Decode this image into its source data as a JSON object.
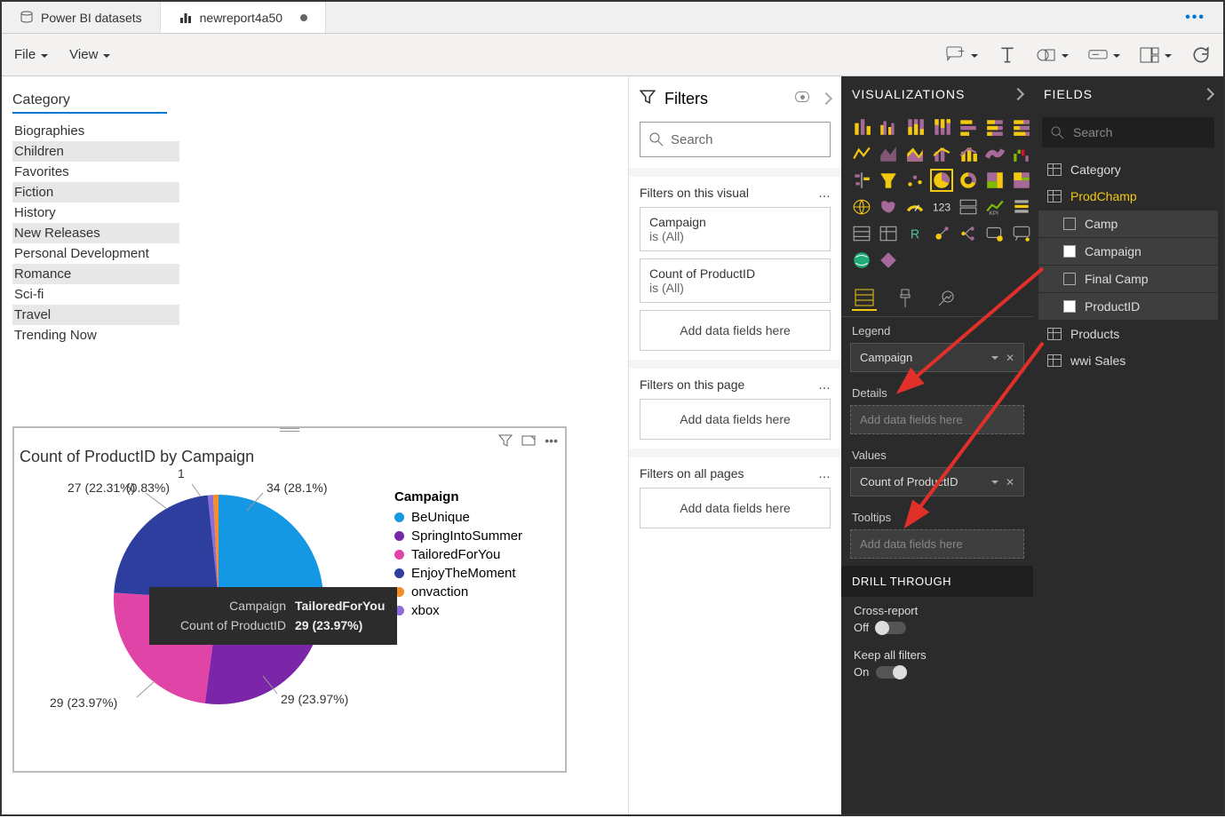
{
  "tabs": {
    "inactive": "Power BI datasets",
    "active": "newreport4a50"
  },
  "menu": {
    "file": "File",
    "view": "View"
  },
  "slicer": {
    "title": "Category",
    "items": [
      "Biographies",
      "Children",
      "Favorites",
      "Fiction",
      "History",
      "New Releases",
      "Personal Development",
      "Romance",
      "Sci-fi",
      "Travel",
      "Trending Now"
    ]
  },
  "pie": {
    "title": "Count of ProductID by Campaign",
    "legend_title": "Campaign",
    "legend": [
      {
        "name": "BeUnique",
        "color": "#1498E4"
      },
      {
        "name": "SpringIntoSummer",
        "color": "#7B26A8"
      },
      {
        "name": "TailoredForYou",
        "color": "#E044A7"
      },
      {
        "name": "EnjoyTheMoment",
        "color": "#2D3E9E"
      },
      {
        "name": "onvaction",
        "color": "#F28E2B"
      },
      {
        "name": "xbox",
        "color": "#8D6CDB"
      }
    ],
    "labels": {
      "top_center": "1",
      "top_center_pct": "(0.83%)",
      "right": "34 (28.1%)",
      "left": "27 (22.31%)",
      "bottom_right": "29 (23.97%)",
      "bottom_left": "29 (23.97%)"
    },
    "tooltip": {
      "campaign_label": "Campaign",
      "campaign_value": "TailoredForYou",
      "count_label": "Count of ProductID",
      "count_value": "29 (23.97%)"
    }
  },
  "chart_data": {
    "type": "pie",
    "title": "Count of ProductID by Campaign",
    "legend_title": "Campaign",
    "series": [
      {
        "name": "BeUnique",
        "value": 34,
        "percent": 28.1,
        "color": "#1498E4"
      },
      {
        "name": "SpringIntoSummer",
        "value": 29,
        "percent": 23.97,
        "color": "#7B26A8"
      },
      {
        "name": "TailoredForYou",
        "value": 29,
        "percent": 23.97,
        "color": "#E044A7"
      },
      {
        "name": "EnjoyTheMoment",
        "value": 27,
        "percent": 22.31,
        "color": "#2D3E9E"
      },
      {
        "name": "onvaction",
        "value": 1,
        "percent": 0.83,
        "color": "#F28E2B"
      },
      {
        "name": "xbox",
        "value": 1,
        "percent": 0.83,
        "color": "#8D6CDB"
      }
    ]
  },
  "filters": {
    "header": "Filters",
    "search_placeholder": "Search",
    "visual_head": "Filters on this visual",
    "visual_cards": [
      {
        "title": "Campaign",
        "sub": "is (All)"
      },
      {
        "title": "Count of ProductID",
        "sub": "is (All)"
      }
    ],
    "add_fields": "Add data fields here",
    "page_head": "Filters on this page",
    "all_head": "Filters on all pages"
  },
  "viz": {
    "header": "VISUALIZATIONS",
    "legend_label": "Legend",
    "legend_field": "Campaign",
    "details_label": "Details",
    "details_placeholder": "Add data fields here",
    "values_label": "Values",
    "values_field": "Count of ProductID",
    "tooltips_label": "Tooltips",
    "tooltips_placeholder": "Add data fields here",
    "drill_header": "DRILL THROUGH",
    "cross_report": "Cross-report",
    "off": "Off",
    "keep_filters": "Keep all filters",
    "on": "On"
  },
  "fields": {
    "header": "FIELDS",
    "search_placeholder": "Search",
    "tables": [
      {
        "name": "Category",
        "highlight": false
      },
      {
        "name": "ProdChamp",
        "highlight": true,
        "columns": [
          {
            "name": "Camp",
            "checked": false
          },
          {
            "name": "Campaign",
            "checked": true
          },
          {
            "name": "Final Camp",
            "checked": false
          },
          {
            "name": "ProductID",
            "checked": true
          }
        ]
      },
      {
        "name": "Products",
        "highlight": false
      },
      {
        "name": "wwi Sales",
        "highlight": false
      }
    ]
  }
}
